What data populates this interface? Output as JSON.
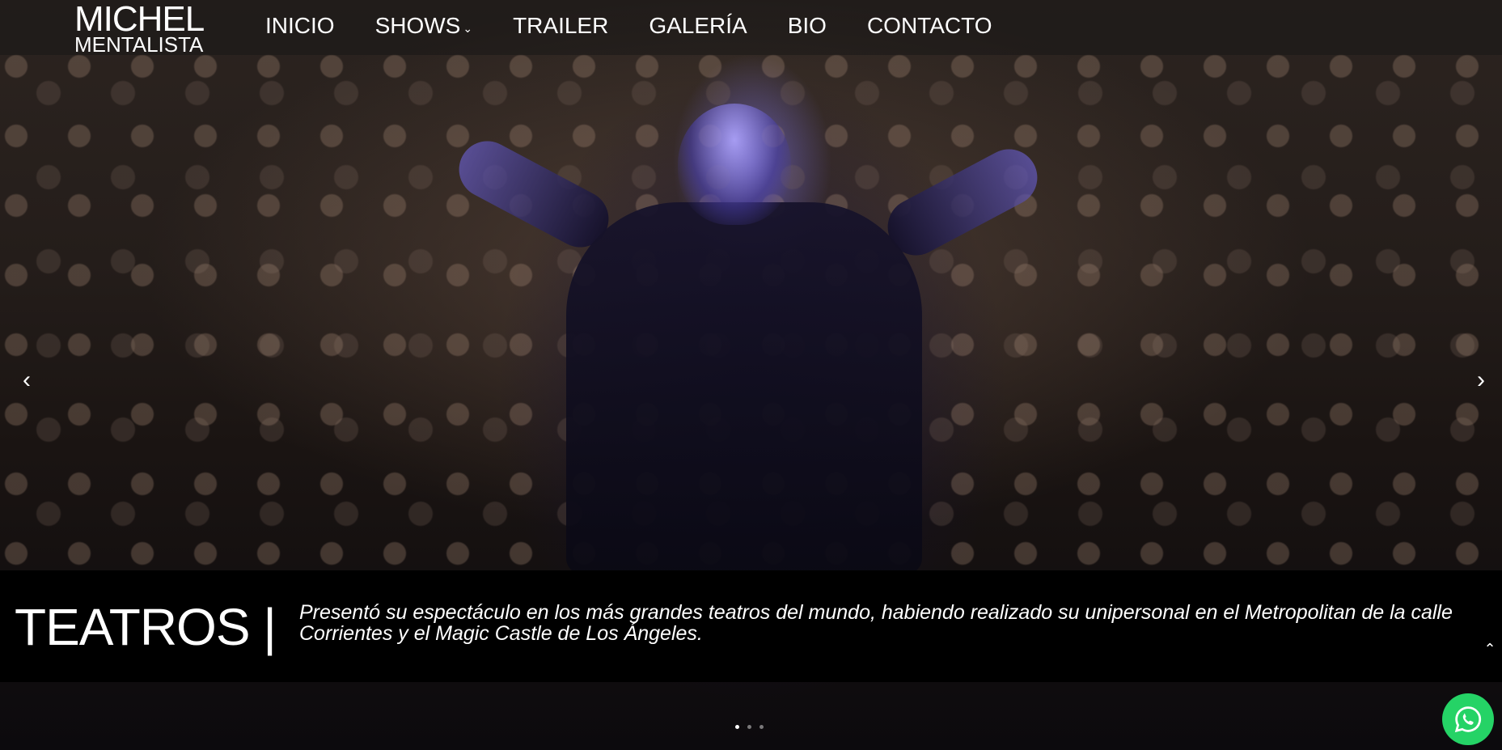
{
  "brand": {
    "line1": "MICHEL",
    "line2": "MENTALISTA"
  },
  "nav": {
    "items": [
      {
        "label": "INICIO"
      },
      {
        "label": "SHOWS",
        "has_dropdown": true
      },
      {
        "label": "TRAILER"
      },
      {
        "label": "GALERÍA"
      },
      {
        "label": "BIO"
      },
      {
        "label": "CONTACTO"
      }
    ]
  },
  "slider": {
    "prev_icon": "chevron-left-icon",
    "next_icon": "chevron-right-icon",
    "dots": 3,
    "active_dot": 1
  },
  "caption": {
    "title": "TEATROS |",
    "text": "Presentó su espectáculo en los más grandes teatros del mundo, habiendo realizado su unipersonal en el Metropolitan de la calle Corrientes y el Magic Castle de Los Ángeles."
  },
  "colors": {
    "whatsapp": "#25d366",
    "caption_bg": "#000000"
  }
}
